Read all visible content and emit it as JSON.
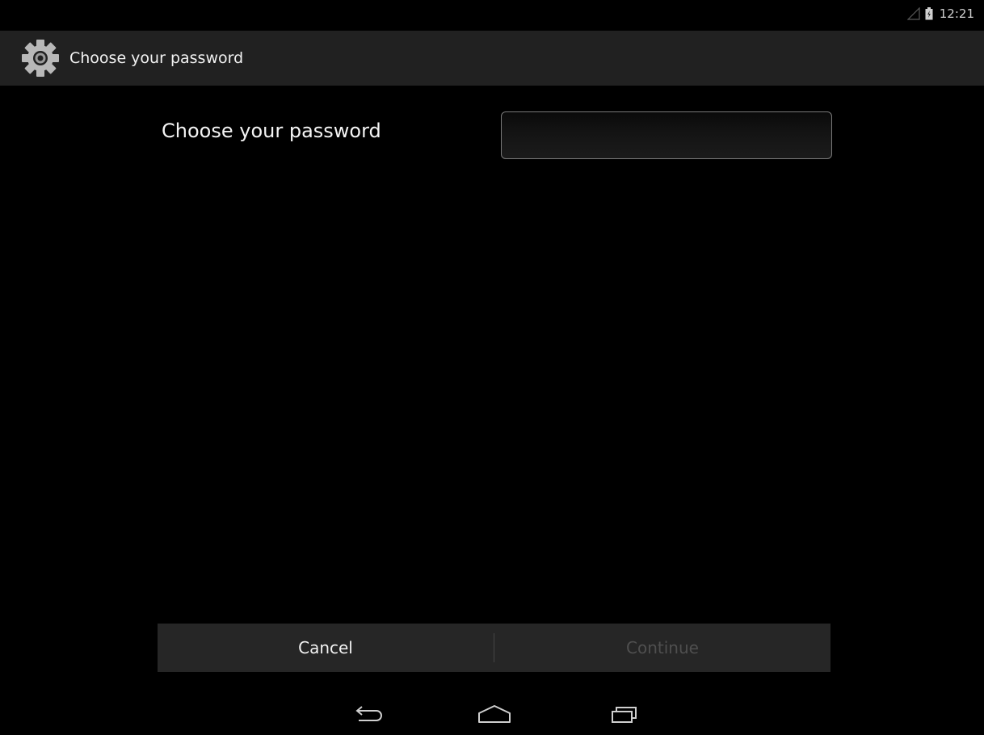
{
  "status_bar": {
    "time": "12:21",
    "icons": [
      "signal-icon",
      "battery-icon"
    ]
  },
  "action_bar": {
    "title": "Choose your password",
    "icon": "settings-gear-icon"
  },
  "form": {
    "label": "Choose your password",
    "password_value": "",
    "password_placeholder": ""
  },
  "buttons": {
    "cancel_label": "Cancel",
    "continue_label": "Continue"
  },
  "nav": {
    "icons": [
      "back-icon",
      "home-icon",
      "recents-icon"
    ]
  },
  "colors": {
    "background": "#000000",
    "action_bar": "#212121",
    "button_bar": "#262626",
    "disabled_text": "#4f4f4f"
  }
}
